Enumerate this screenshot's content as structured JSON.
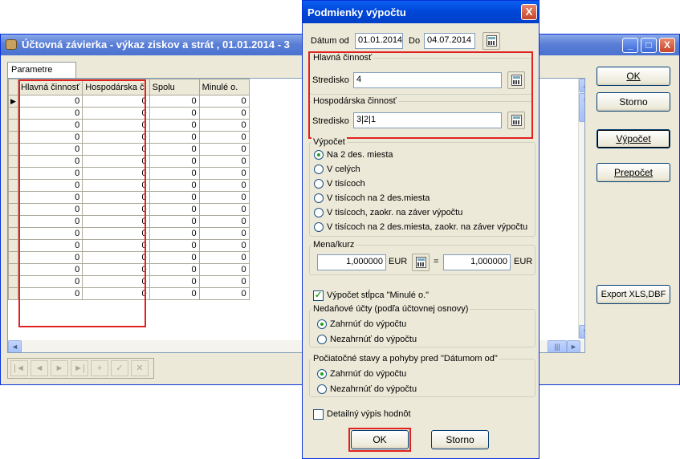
{
  "bg_window": {
    "title": "Účtovná závierka - výkaz ziskov a strát ,  01.01.2014 - 3",
    "controls": {
      "minimize": "_",
      "maximize": "□",
      "close": "X"
    },
    "tab": "Parametre",
    "columns": [
      "Hlavná činnosť",
      "Hospodárska č.",
      "Spolu",
      "Minulé o."
    ],
    "rows": [
      [
        "0",
        "0",
        "0",
        "0"
      ],
      [
        "0",
        "0",
        "0",
        "0"
      ],
      [
        "0",
        "0",
        "0",
        "0"
      ],
      [
        "0",
        "0",
        "0",
        "0"
      ],
      [
        "0",
        "0",
        "0",
        "0"
      ],
      [
        "0",
        "0",
        "0",
        "0"
      ],
      [
        "0",
        "0",
        "0",
        "0"
      ],
      [
        "0",
        "0",
        "0",
        "0"
      ],
      [
        "0",
        "0",
        "0",
        "0"
      ],
      [
        "0",
        "0",
        "0",
        "0"
      ],
      [
        "0",
        "0",
        "0",
        "0"
      ],
      [
        "0",
        "0",
        "0",
        "0"
      ],
      [
        "0",
        "0",
        "0",
        "0"
      ],
      [
        "0",
        "0",
        "0",
        "0"
      ],
      [
        "0",
        "0",
        "0",
        "0"
      ],
      [
        "0",
        "0",
        "0",
        "0"
      ],
      [
        "0",
        "0",
        "0",
        "0"
      ]
    ],
    "buttons": {
      "ok": "OK",
      "storno": "Storno",
      "vypocet": "Výpočet",
      "prepocet": "Prepočet",
      "export": "Export XLS,DBF"
    },
    "nav_buttons": [
      "|◄",
      "◄",
      "►",
      "►|",
      "+",
      "✓",
      "✕"
    ]
  },
  "dialog": {
    "title": "Podmienky výpočtu",
    "close": "X",
    "datum_od_label": "Dátum od",
    "datum_od": "01.01.2014",
    "do_label": "Do",
    "datum_do": "04.07.2014",
    "hlavna_group": "Hlavná činnosť",
    "stredisko_label": "Stredisko",
    "hlavna_stredisko": "4",
    "hospodarska_group": "Hospodárska činnosť",
    "hospodarska_stredisko": "3|2|1",
    "vypocet_group": "Výpočet",
    "vypocet_options": [
      "Na 2 des. miesta",
      "V celých",
      "V tisícoch",
      "V tisícoch na 2 des.miesta",
      "V tisícoch, zaokr. na záver výpočtu",
      "V tisícoch na 2 des.miesta, zaokr. na záver výpočtu"
    ],
    "vypocet_selected": 0,
    "mena_group": "Mena/kurz",
    "mena_value1": "1,000000",
    "mena_cur1": "EUR",
    "mena_eq": "=",
    "mena_value2": "1,000000",
    "mena_cur2": "EUR",
    "vypocet_stlpca": "Výpočet stĺpca \"Minulé o.\"",
    "vypocet_stlpca_checked": true,
    "nedanove_group": "Nedaňové účty (podľa účtovnej osnovy)",
    "nedanove_options": [
      "Zahrnúť do výpočtu",
      "Nezahrnúť do výpočtu"
    ],
    "pociatocne_group": "Počiatočné stavy a pohyby pred \"Dátumom od\"",
    "pociatocne_options": [
      "Zahrnúť do výpočtu",
      "Nezahrnúť do výpočtu"
    ],
    "detailny": "Detailný výpis hodnôt",
    "ok": "OK",
    "storno": "Storno"
  },
  "colors": {
    "highlight": "#e0221f",
    "xp_blue": "#0046d8",
    "face": "#ece9d8"
  }
}
